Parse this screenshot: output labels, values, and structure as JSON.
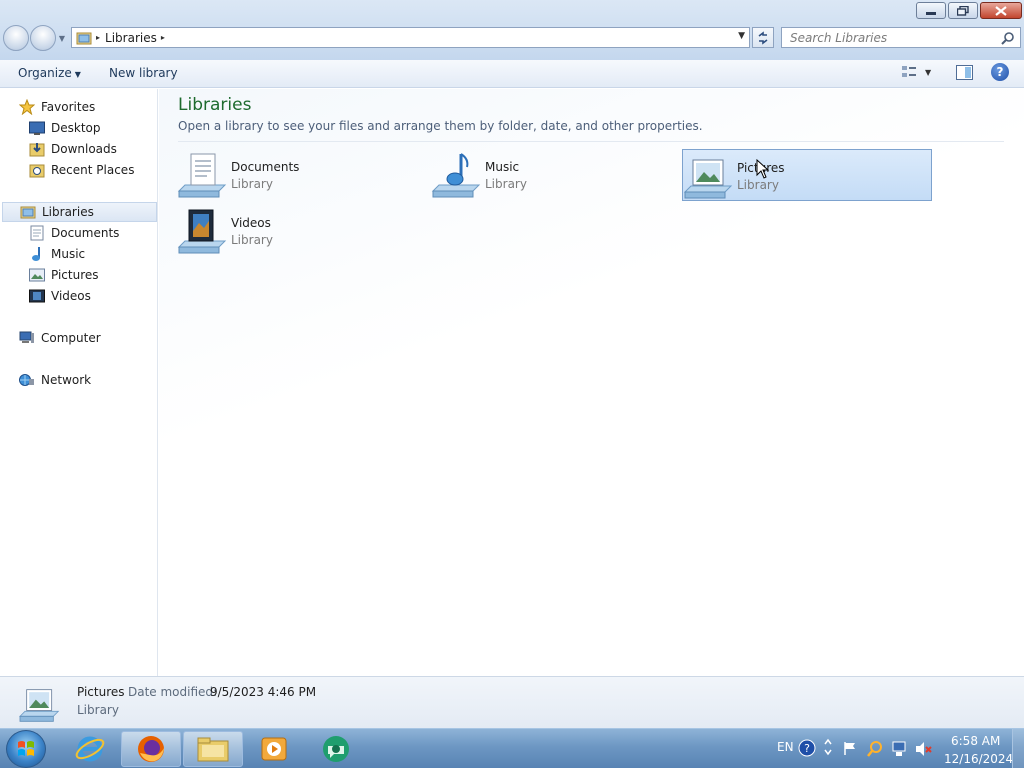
{
  "window": {
    "minimize_icon": "minimize-icon",
    "maximize_icon": "restore-icon",
    "close_icon": "close-icon"
  },
  "address": {
    "path": "Libraries",
    "separator": "▸"
  },
  "search": {
    "placeholder": "Search Libraries"
  },
  "toolbar": {
    "organize_label": "Organize",
    "new_library_label": "New library"
  },
  "nav": {
    "favorites": "Favorites",
    "desktop": "Desktop",
    "downloads": "Downloads",
    "recent_places": "Recent Places",
    "libraries": "Libraries",
    "documents": "Documents",
    "music": "Music",
    "pictures": "Pictures",
    "videos": "Videos",
    "computer": "Computer",
    "network": "Network"
  },
  "content": {
    "heading": "Libraries",
    "subheading": "Open a library to see your files and arrange them by folder, date, and other properties.",
    "items": [
      {
        "name": "Documents",
        "type": "Library"
      },
      {
        "name": "Music",
        "type": "Library"
      },
      {
        "name": "Pictures",
        "type": "Library"
      },
      {
        "name": "Videos",
        "type": "Library"
      }
    ]
  },
  "details": {
    "name": "Pictures",
    "modified_label": "Date modified:",
    "modified_value": "9/5/2023 4:46 PM",
    "type": "Library"
  },
  "taskbar": {
    "language": "EN",
    "time": "6:58 AM",
    "date": "12/16/2024"
  },
  "colors": {
    "heading_green": "#1e6b2e",
    "selection_blue": "#c4dcf6",
    "taskbar_blue": "#6d97c3"
  }
}
